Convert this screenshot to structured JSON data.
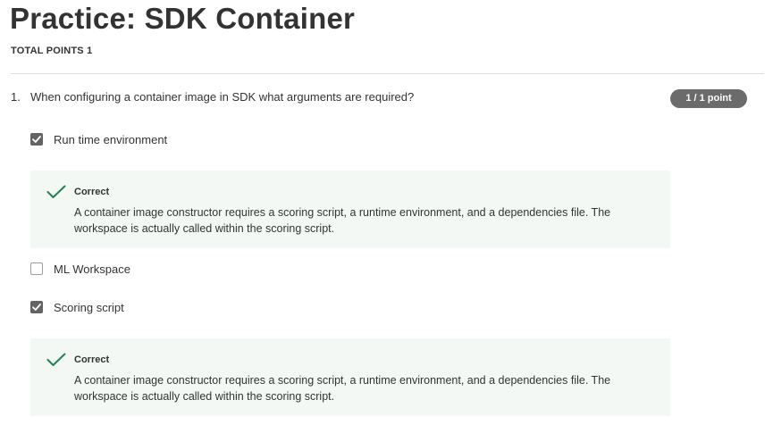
{
  "page": {
    "title": "Practice: SDK Container",
    "total_points": "TOTAL POINTS 1"
  },
  "question": {
    "number": "1.",
    "text": "When configuring a container image in SDK what arguments are required?",
    "score_badge": "1 / 1 point",
    "options": [
      {
        "label": "Run time environment",
        "checked": true
      },
      {
        "label": "ML Workspace",
        "checked": false
      },
      {
        "label": "Scoring script",
        "checked": true
      }
    ],
    "feedback": [
      {
        "status": "Correct",
        "text": "A container image constructor requires a scoring script, a runtime environment, and a dependencies file. The workspace is actually called within the scoring script."
      },
      {
        "status": "Correct",
        "text": "A container image constructor requires a scoring script, a runtime environment, and a dependencies file. The workspace is actually called within the scoring script."
      }
    ]
  },
  "colors": {
    "correct_check": "#1f8354",
    "feedback_bg": "#f3f8f5",
    "badge_bg": "#6b6b6b"
  }
}
